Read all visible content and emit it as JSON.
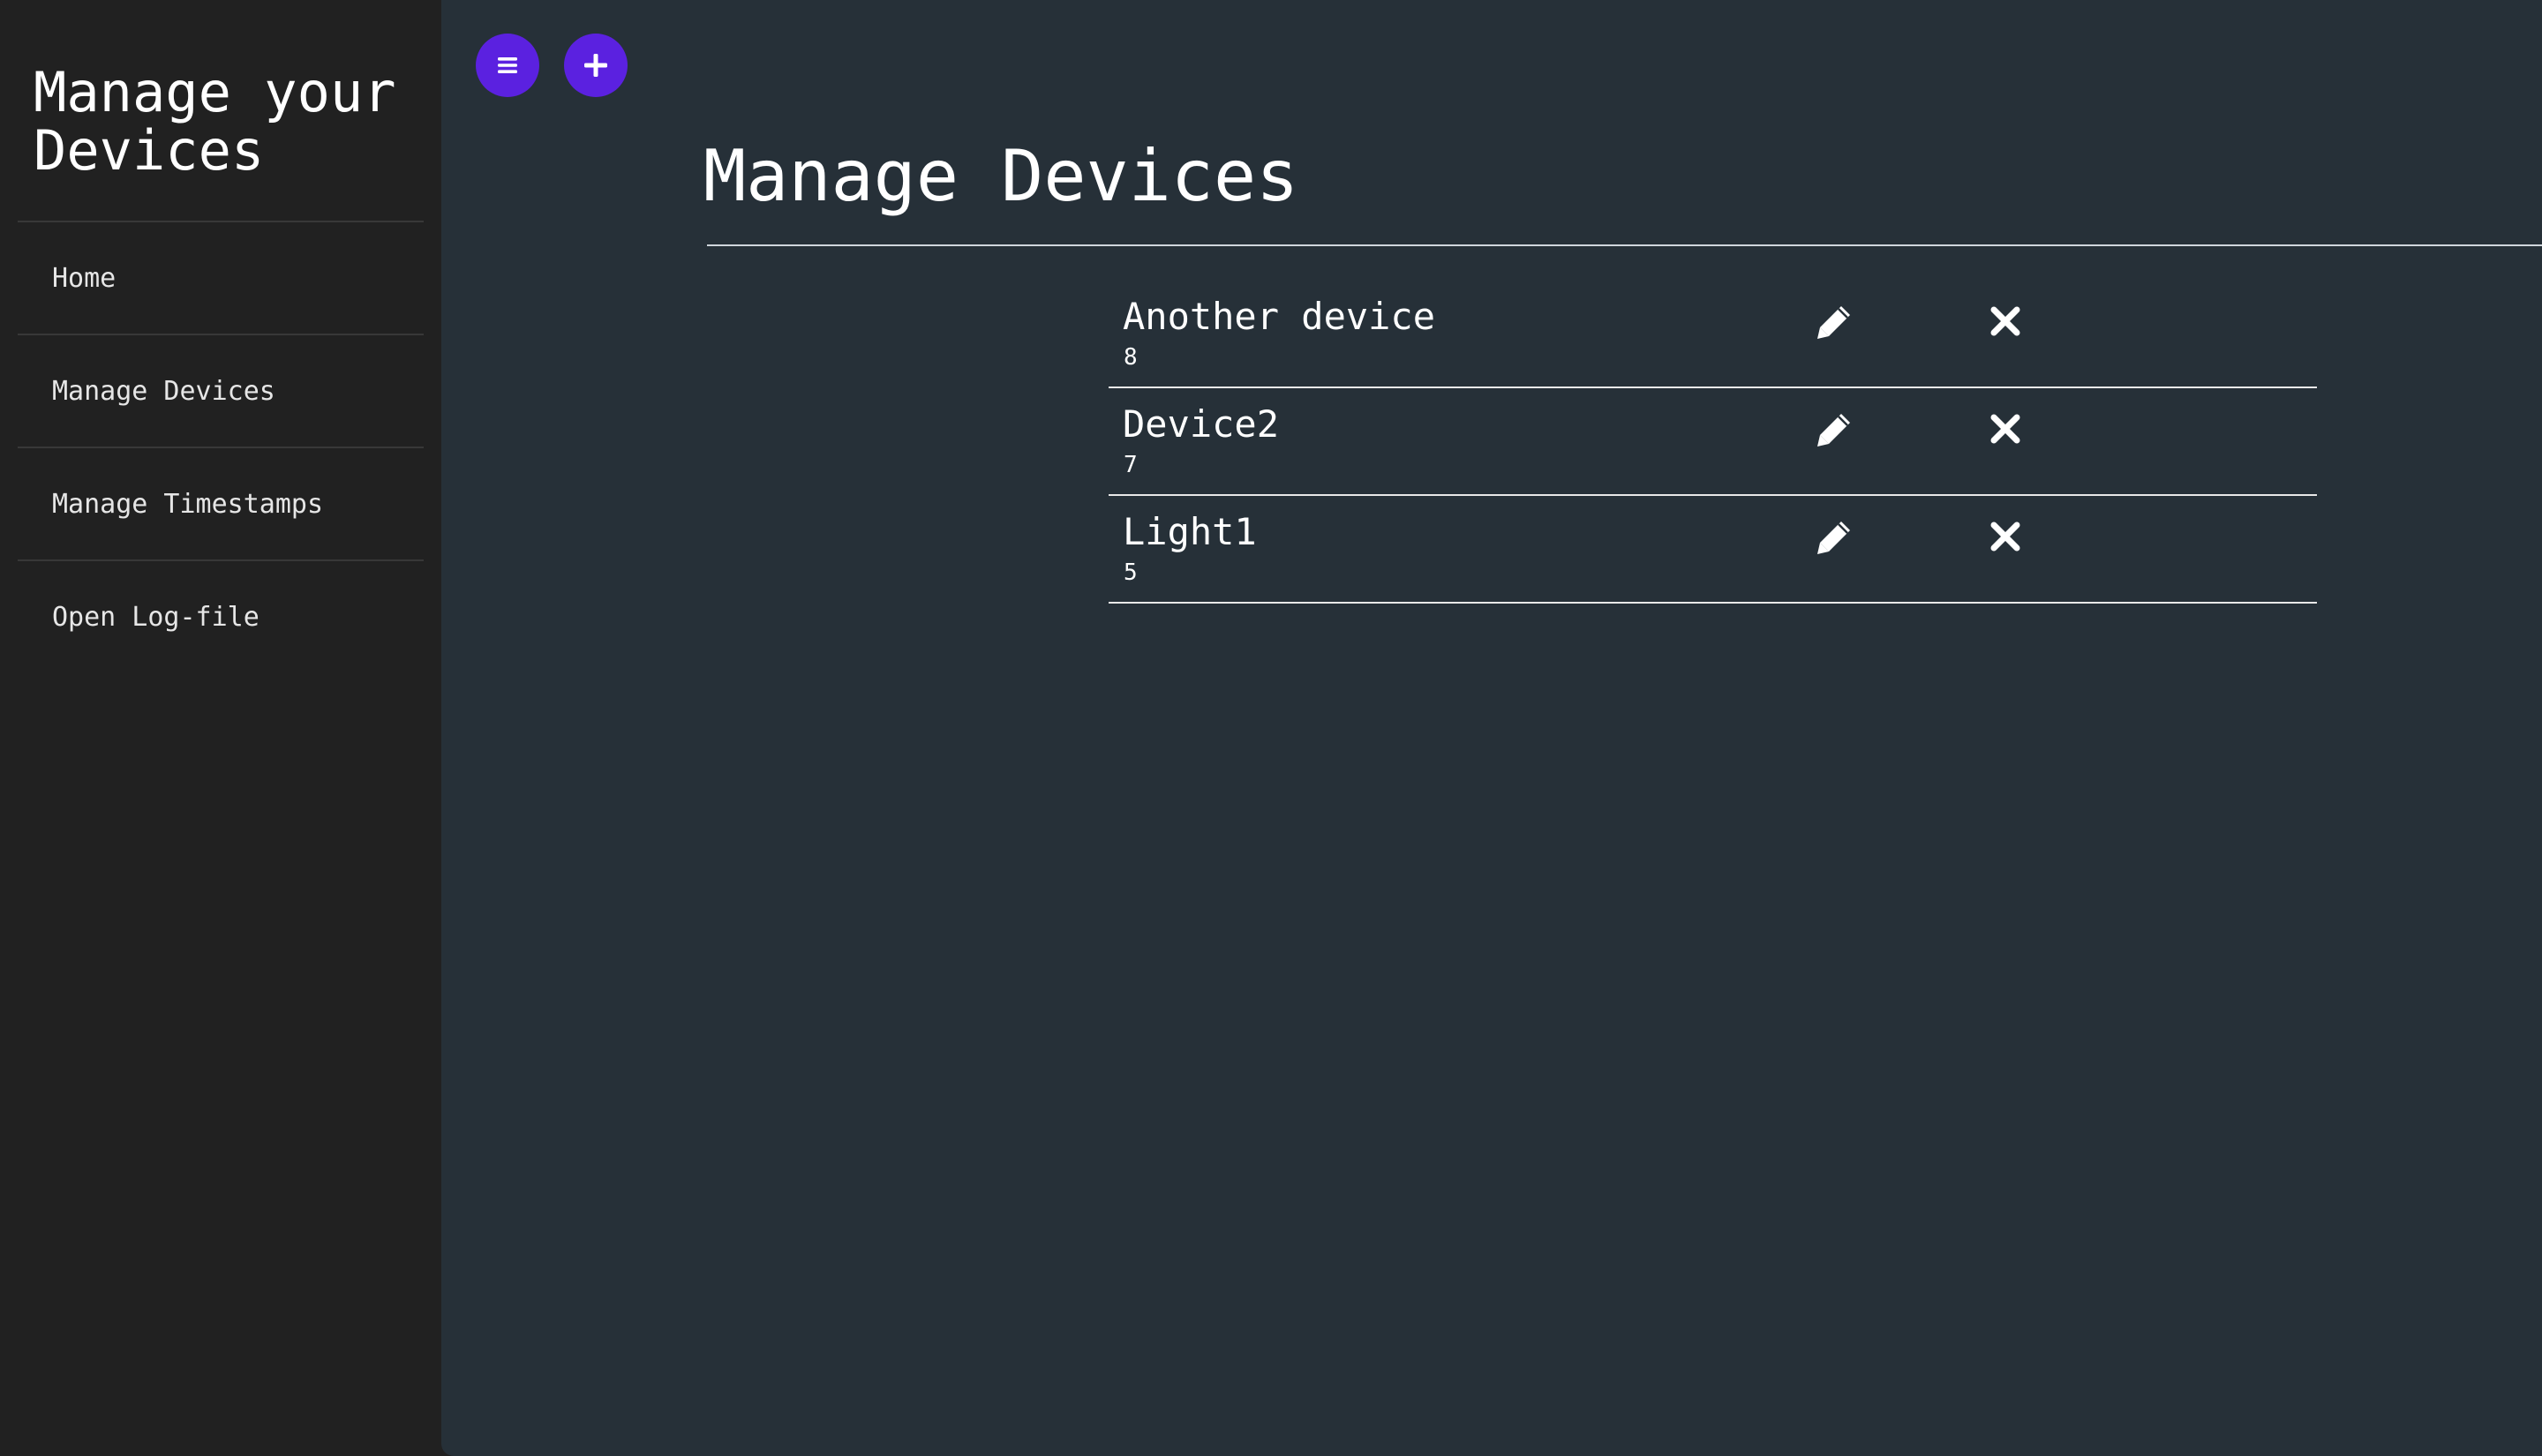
{
  "sidebar": {
    "title": "Manage your Devices",
    "items": [
      {
        "label": "Home"
      },
      {
        "label": "Manage Devices"
      },
      {
        "label": "Manage Timestamps"
      },
      {
        "label": "Open Log-file"
      }
    ]
  },
  "toolbar": {
    "menu_icon": "menu-icon",
    "add_icon": "plus-icon",
    "accent_color": "#5b21e0"
  },
  "main": {
    "title": "Manage Devices",
    "devices": [
      {
        "name": "Another device",
        "id": "8"
      },
      {
        "name": "Device2",
        "id": "7"
      },
      {
        "name": "Light1",
        "id": "5"
      }
    ]
  },
  "colors": {
    "sidebar_bg": "#212121",
    "main_bg": "#263038",
    "text": "#ffffff"
  }
}
